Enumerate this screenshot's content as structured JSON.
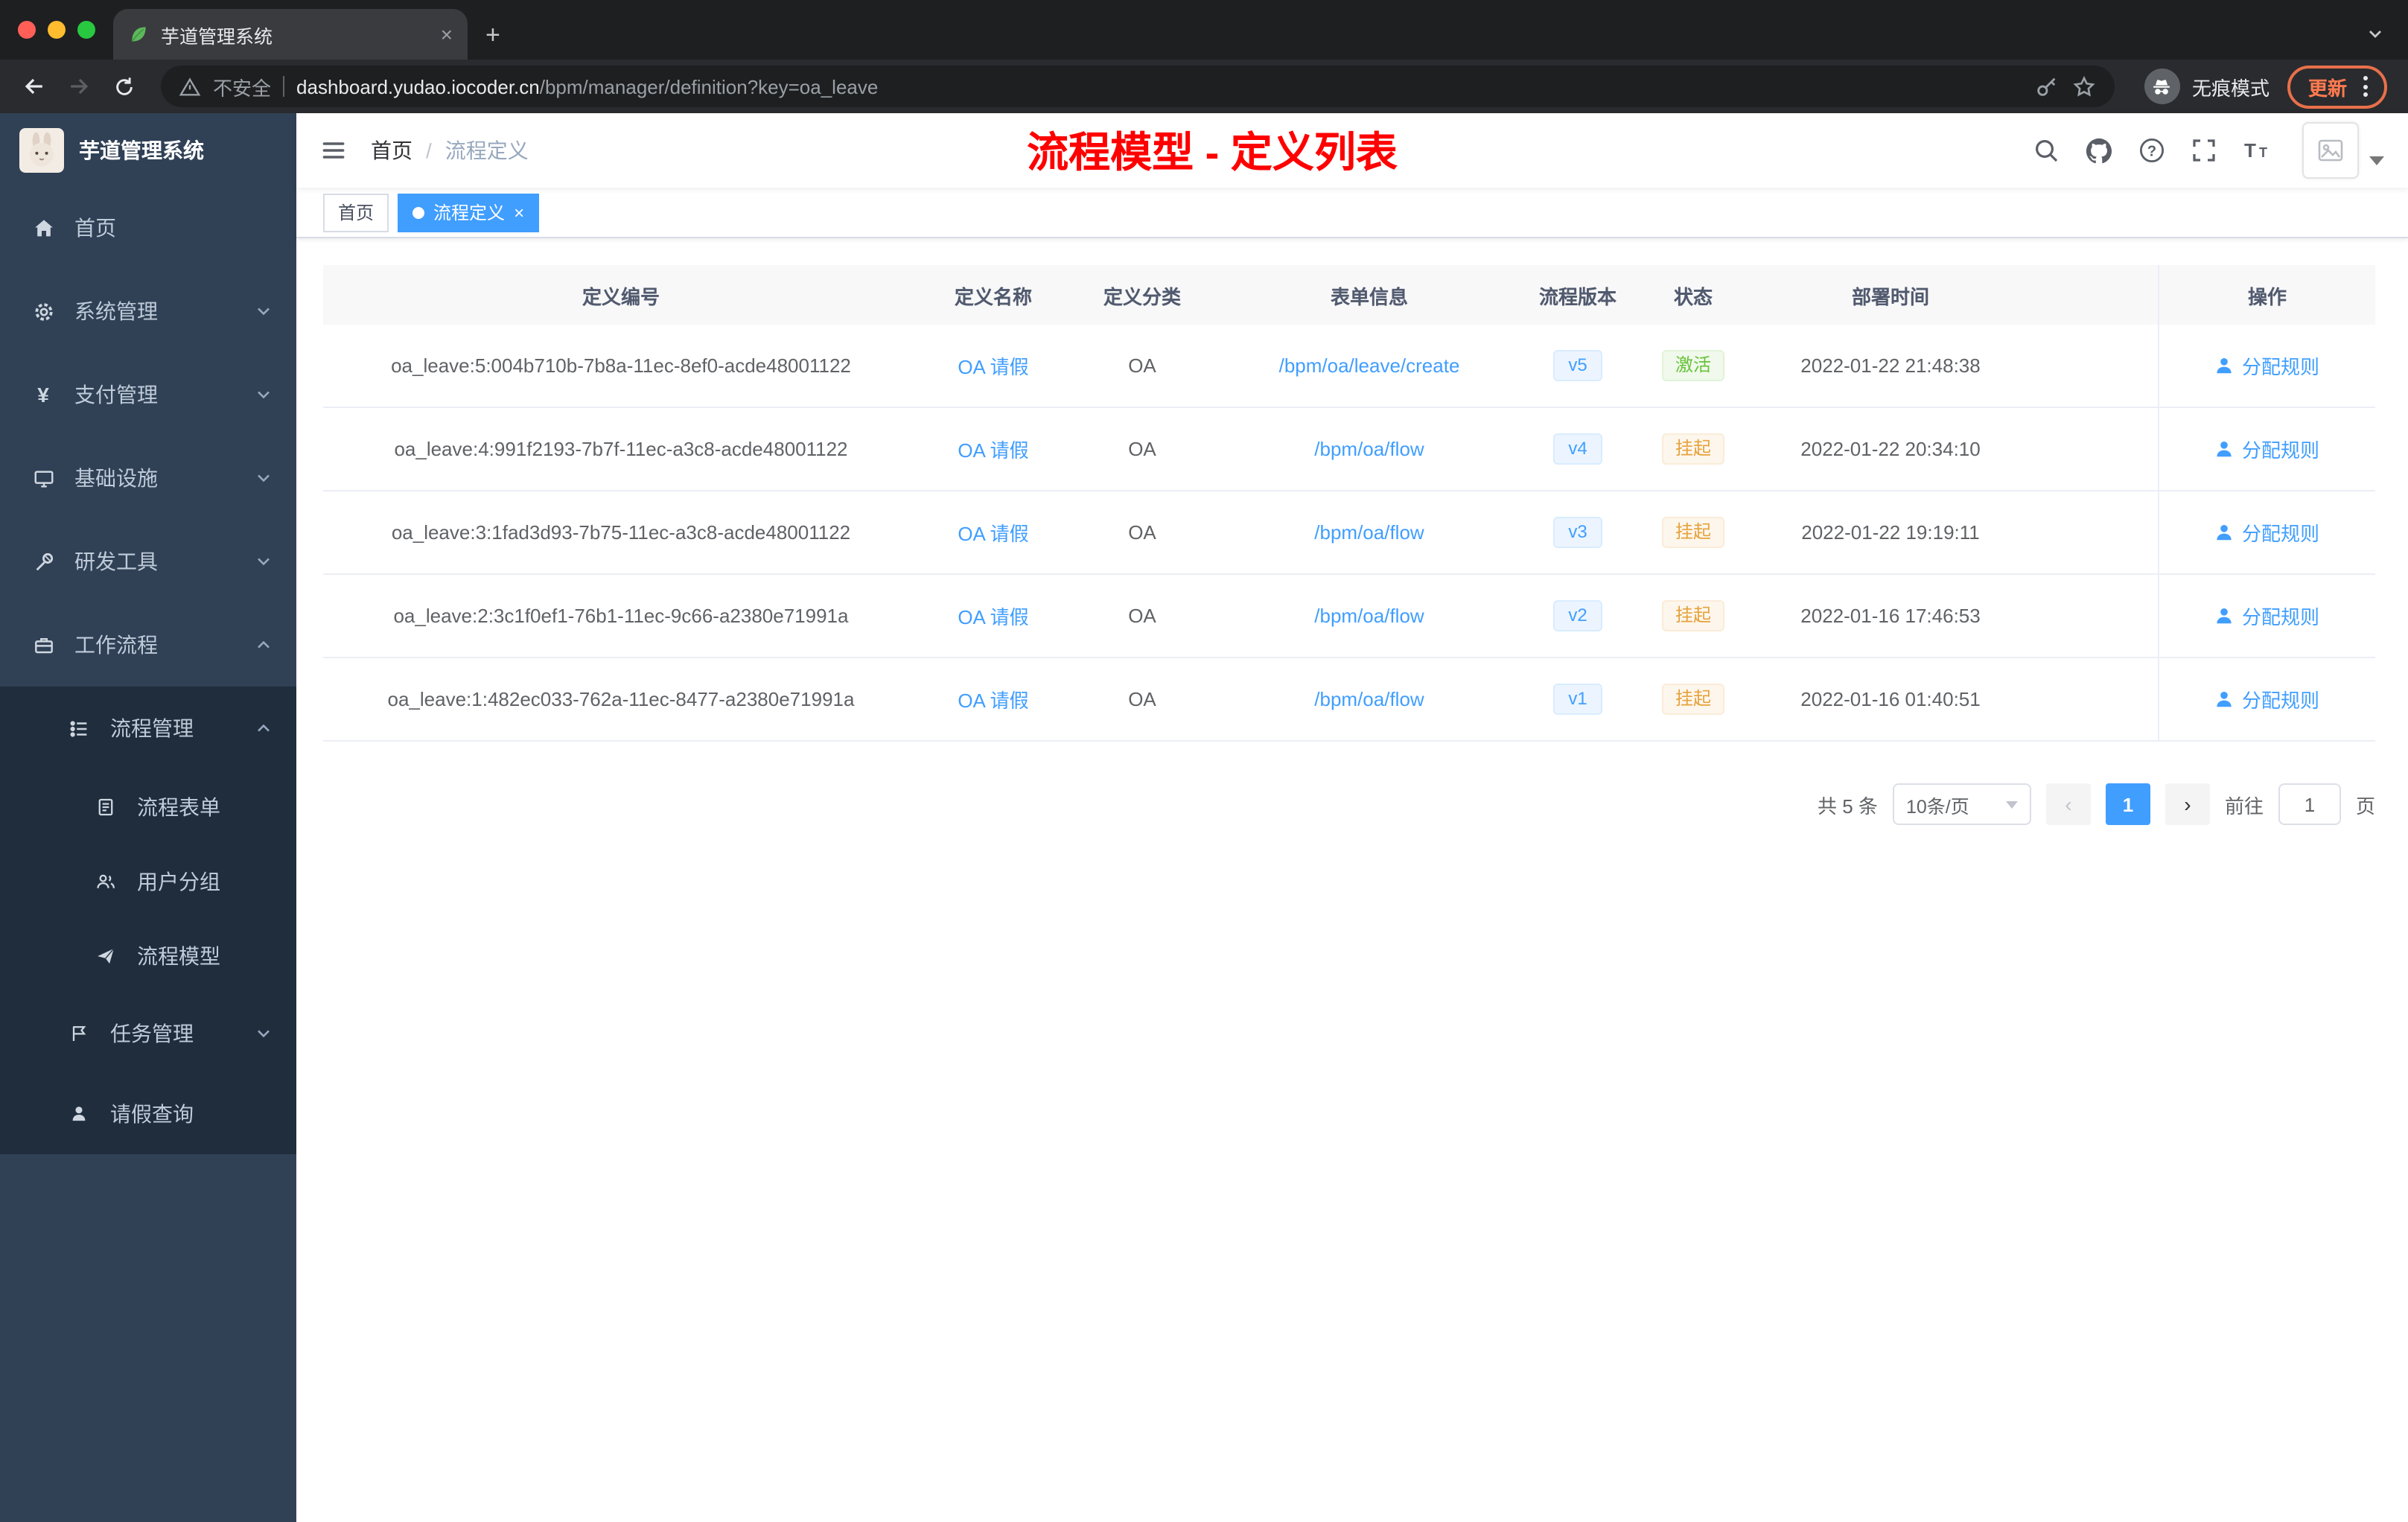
{
  "browser": {
    "tab_title": "芋道管理系统",
    "tab_close": "×",
    "new_tab_label": "+",
    "security_label": "不安全",
    "url_host": "dashboard.yudao.iocoder.cn",
    "url_path": "/bpm/manager/definition?key=oa_leave",
    "incognito_label": "无痕模式",
    "update_label": "更新"
  },
  "sidebar": {
    "logo_title": "芋道管理系统",
    "items": [
      {
        "label": "首页"
      },
      {
        "label": "系统管理"
      },
      {
        "label": "支付管理"
      },
      {
        "label": "基础设施"
      },
      {
        "label": "研发工具"
      },
      {
        "label": "工作流程"
      },
      {
        "label": "流程管理"
      },
      {
        "label": "流程表单"
      },
      {
        "label": "用户分组"
      },
      {
        "label": "流程模型"
      },
      {
        "label": "任务管理"
      },
      {
        "label": "请假查询"
      }
    ]
  },
  "header": {
    "breadcrumb_home": "首页",
    "breadcrumb_sep": "/",
    "breadcrumb_current": "流程定义",
    "annotation": "流程模型 - 定义列表"
  },
  "tags": {
    "home": "首页",
    "active": "流程定义",
    "close": "×"
  },
  "table": {
    "columns": {
      "id": "定义编号",
      "name": "定义名称",
      "category": "定义分类",
      "form": "表单信息",
      "version": "流程版本",
      "status": "状态",
      "deploy": "部署时间",
      "action": "操作"
    },
    "rows": [
      {
        "id": "oa_leave:5:004b710b-7b8a-11ec-8ef0-acde48001122",
        "name": "OA 请假",
        "category": "OA",
        "form": "/bpm/oa/leave/create",
        "version": "v5",
        "status": "激活",
        "status_type": "success",
        "deploy": "2022-01-22 21:48:38",
        "action": "分配规则"
      },
      {
        "id": "oa_leave:4:991f2193-7b7f-11ec-a3c8-acde48001122",
        "name": "OA 请假",
        "category": "OA",
        "form": "/bpm/oa/flow",
        "version": "v4",
        "status": "挂起",
        "status_type": "warning",
        "deploy": "2022-01-22 20:34:10",
        "action": "分配规则"
      },
      {
        "id": "oa_leave:3:1fad3d93-7b75-11ec-a3c8-acde48001122",
        "name": "OA 请假",
        "category": "OA",
        "form": "/bpm/oa/flow",
        "version": "v3",
        "status": "挂起",
        "status_type": "warning",
        "deploy": "2022-01-22 19:19:11",
        "action": "分配规则"
      },
      {
        "id": "oa_leave:2:3c1f0ef1-76b1-11ec-9c66-a2380e71991a",
        "name": "OA 请假",
        "category": "OA",
        "form": "/bpm/oa/flow",
        "version": "v2",
        "status": "挂起",
        "status_type": "warning",
        "deploy": "2022-01-16 17:46:53",
        "action": "分配规则"
      },
      {
        "id": "oa_leave:1:482ec033-762a-11ec-8477-a2380e71991a",
        "name": "OA 请假",
        "category": "OA",
        "form": "/bpm/oa/flow",
        "version": "v1",
        "status": "挂起",
        "status_type": "warning",
        "deploy": "2022-01-16 01:40:51",
        "action": "分配规则"
      }
    ]
  },
  "pagination": {
    "total": "共 5 条",
    "page_size": "10条/页",
    "prev": "‹",
    "next": "›",
    "current_page": "1",
    "goto_label": "前往",
    "goto_value": "1",
    "page_unit": "页"
  },
  "colors": {
    "accent": "#409eff",
    "success": "#67c23a",
    "warning": "#e6a23c",
    "annotation_red": "#ff0000",
    "sidebar_bg": "#304156",
    "submenu_bg": "#1f2d3d"
  },
  "icons": {
    "favicon": "green-leaf",
    "status_active_tag": "green",
    "status_suspend_tag": "orange"
  }
}
